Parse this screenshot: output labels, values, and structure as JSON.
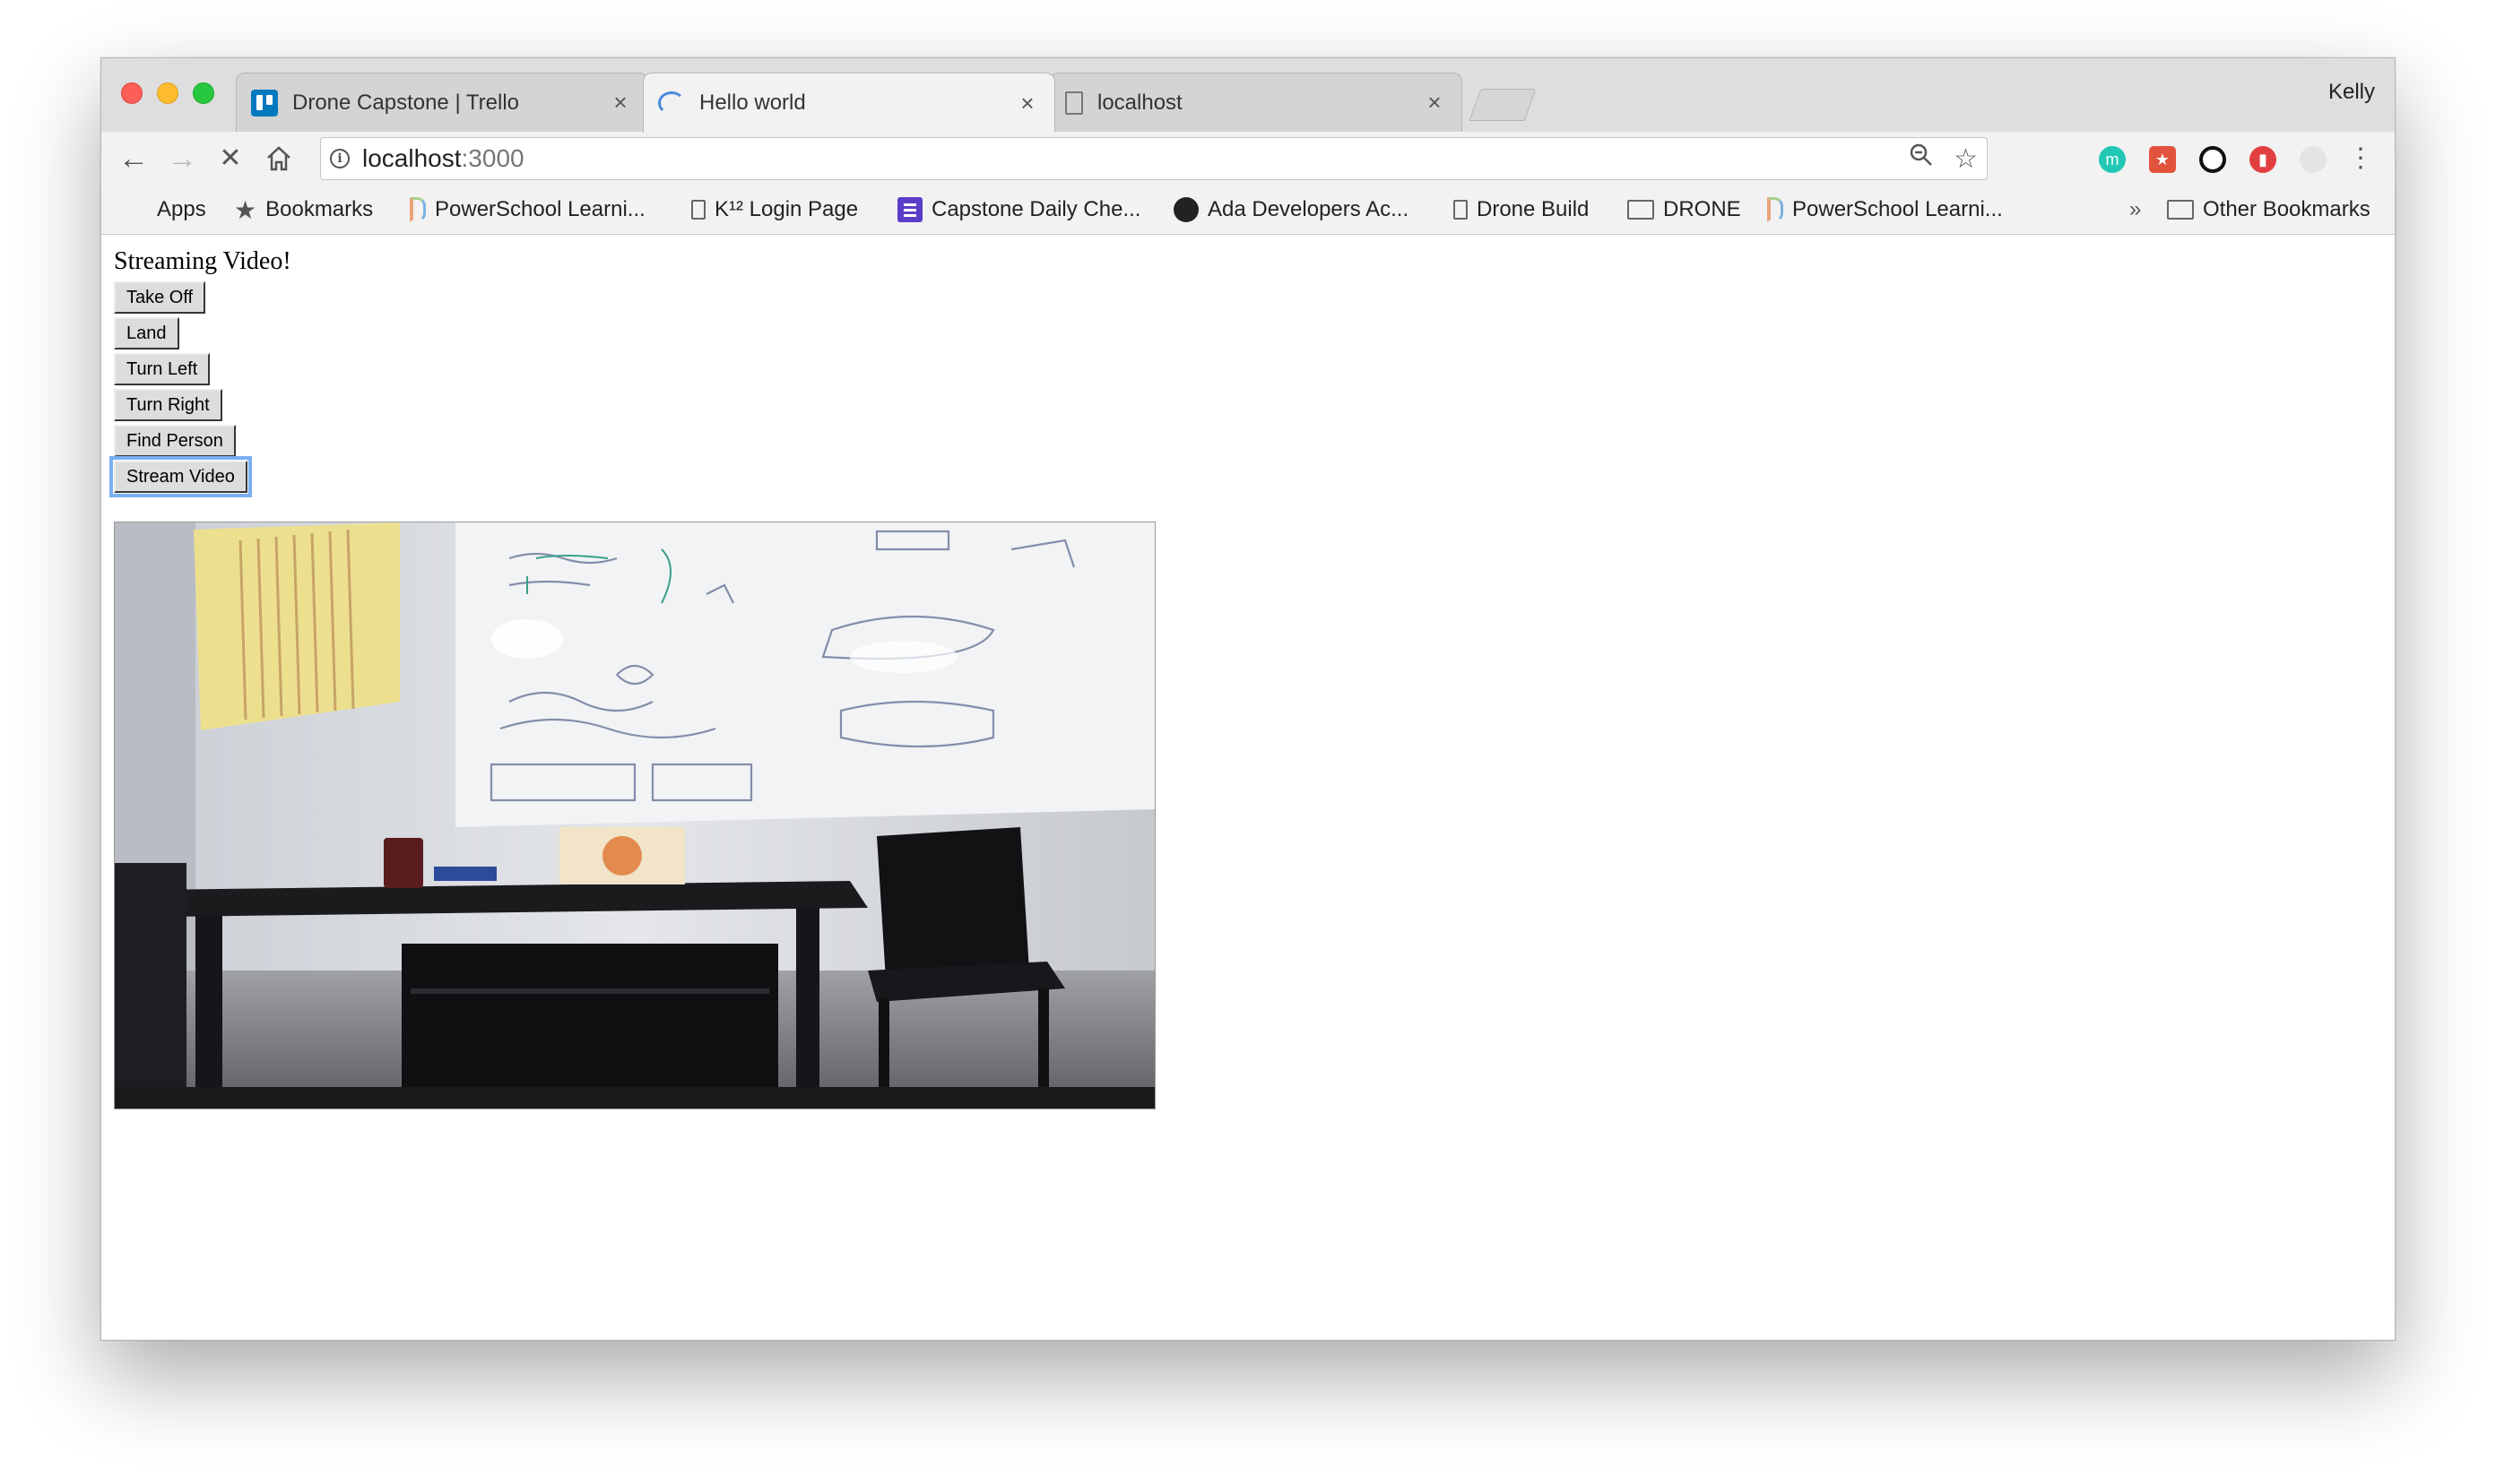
{
  "browser": {
    "tabs": [
      {
        "title": "Drone Capstone | Trello",
        "icon": "trello-icon",
        "active": false
      },
      {
        "title": "Hello world",
        "icon": "loading-spinner-icon",
        "active": true
      },
      {
        "title": "localhost",
        "icon": "page-icon",
        "active": false
      }
    ],
    "tab_close": "×",
    "profile_name": "Kelly",
    "url_host": "localhost",
    "url_path": ":3000",
    "bookmarks": [
      {
        "label": "Apps",
        "icon": "apps-grid-icon"
      },
      {
        "label": "Bookmarks",
        "icon": "star-icon"
      },
      {
        "label": "PowerSchool Learni...",
        "icon": "powerschool-icon"
      },
      {
        "label": "K¹² Login Page",
        "icon": "page-icon"
      },
      {
        "label": "Capstone Daily Che...",
        "icon": "list-icon"
      },
      {
        "label": "Ada Developers Ac...",
        "icon": "github-icon"
      },
      {
        "label": "Drone Build",
        "icon": "page-icon"
      },
      {
        "label": "DRONE",
        "icon": "folder-icon"
      },
      {
        "label": "PowerSchool Learni...",
        "icon": "powerschool-icon"
      }
    ],
    "bookmarks_overflow": "»",
    "other_bookmarks": "Other Bookmarks"
  },
  "page": {
    "heading": "Streaming Video!",
    "buttons": [
      "Take Off",
      "Land",
      "Turn Left",
      "Turn Right",
      "Find Person",
      "Stream Video"
    ],
    "focused_button": "Stream Video"
  },
  "colors": {
    "focus_ring": "#7aaef2",
    "trello_blue": "#0079bf",
    "capstone_purple": "#5b3ec8"
  }
}
